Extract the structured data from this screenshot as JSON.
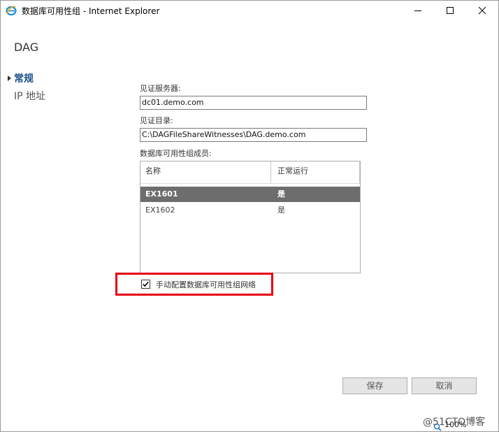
{
  "window": {
    "title": "数据库可用性组 - Internet Explorer",
    "icon": "ie-icon"
  },
  "dialog": {
    "title": "DAG"
  },
  "nav": {
    "items": [
      {
        "label": "常规",
        "selected": true
      },
      {
        "label": "IP 地址",
        "selected": false
      }
    ]
  },
  "form": {
    "witness_server_label": "见证服务器:",
    "witness_server_value": "dc01.demo.com",
    "witness_dir_label": "见证目录:",
    "witness_dir_value": "C:\\DAGFileShareWitnesses\\DAG.demo.com",
    "members_label": "数据库可用性组成员:",
    "members_table": {
      "columns": [
        "名称",
        "正常运行"
      ],
      "rows": [
        {
          "name": "EX1601",
          "status": "是",
          "selected": true
        },
        {
          "name": "EX1602",
          "status": "是",
          "selected": false
        }
      ]
    },
    "manual_network_label": "手动配置数据库可用性组网络",
    "manual_network_checked": true
  },
  "buttons": {
    "save": "保存",
    "cancel": "取消"
  },
  "footer": {
    "zoom": "100%",
    "watermark": "@51CTO博客"
  },
  "colors": {
    "highlight": "#e60012",
    "selected_row": "#6d6d6d",
    "nav_selected": "#1a4f8a"
  }
}
